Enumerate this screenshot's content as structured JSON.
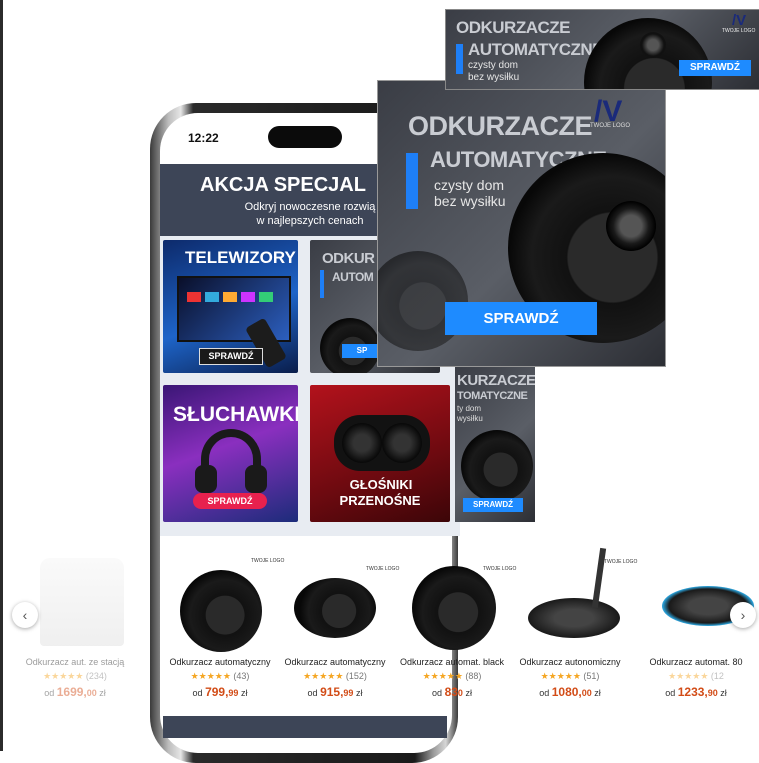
{
  "phone": {
    "time": "12:22"
  },
  "promo": {
    "title": "AKCJA SPECJAL",
    "subtitle_line1": "Odkryj nowoczesne rozwią",
    "subtitle_line2": "w najlepszych cenach"
  },
  "tiles": {
    "tv": {
      "label": "TELEWIZORY",
      "button": "SPRAWDŹ"
    },
    "robot": {
      "label_line1": "ODKUR",
      "label_line2": "AUTOM",
      "button": "SP"
    },
    "headphones": {
      "label": "SŁUCHAWKI",
      "button": "SPRAWDŹ"
    },
    "speakers": {
      "label_line1": "GŁOŚNIKI",
      "label_line2": "PRZENOŚNE"
    }
  },
  "banner_big": {
    "title_line1": "ODKURZACZE",
    "title_line2": "AUTOMATYCZNE",
    "tagline_line1": "czysty dom",
    "tagline_line2": "bez wysiłku",
    "button": "SPRAWDŹ",
    "logo_text": "TWOJE LOGO"
  },
  "banner_top": {
    "title_line1": "ODKURZACZE",
    "title_line2": "AUTOMATYCZNE",
    "tagline_line1": "czysty dom",
    "tagline_line2": "bez wysiłku",
    "button": "SPRAWDŹ",
    "logo_text": "TWOJE LOGO"
  },
  "banner_mid": {
    "title_line1": "KURZACZE",
    "title_line2": "TOMATYCZNE",
    "tagline_line1": "ty dom",
    "tagline_line2": "wysiłku",
    "button": "SPRAWDŹ"
  },
  "products": [
    {
      "name": "Odkurzacz aut. ze stacją",
      "rating_count": "(234)",
      "price_prefix": "od",
      "price_main": "1699,",
      "price_cents": "00",
      "currency": "zł"
    },
    {
      "name": "Odkurzacz automatyczny",
      "rating_count": "(43)",
      "price_prefix": "od",
      "price_main": "799,",
      "price_cents": "99",
      "currency": "zł",
      "logo": "TWOJE LOGO"
    },
    {
      "name": "Odkurzacz automatyczny",
      "rating_count": "(152)",
      "price_prefix": "od",
      "price_main": "915,",
      "price_cents": "99",
      "currency": "zł",
      "logo": "TWOJE LOGO"
    },
    {
      "name": "Odkurzacz automat. black",
      "rating_count": "(88)",
      "price_prefix": "od",
      "price_main": "83",
      "price_cents": "0",
      "currency": "zł",
      "logo": "TWOJE LOGO"
    },
    {
      "name": "Odkurzacz autonomiczny",
      "rating_count": "(51)",
      "price_prefix": "od",
      "price_main": "1080,",
      "price_cents": "00",
      "currency": "zł",
      "logo": "TWOJE LOGO"
    },
    {
      "name": "Odkurzacz automat. 80",
      "rating_count": "(12",
      "price_prefix": "od",
      "price_main": "1233,",
      "price_cents": "90",
      "currency": "zł"
    }
  ],
  "stars": "★★★★★",
  "nav": {
    "prev": "‹",
    "next": "›"
  },
  "colors": {
    "accent": "#1e8bff",
    "price": "#d24c17",
    "star": "#f5a623",
    "promo_bg": "#3d4557"
  }
}
